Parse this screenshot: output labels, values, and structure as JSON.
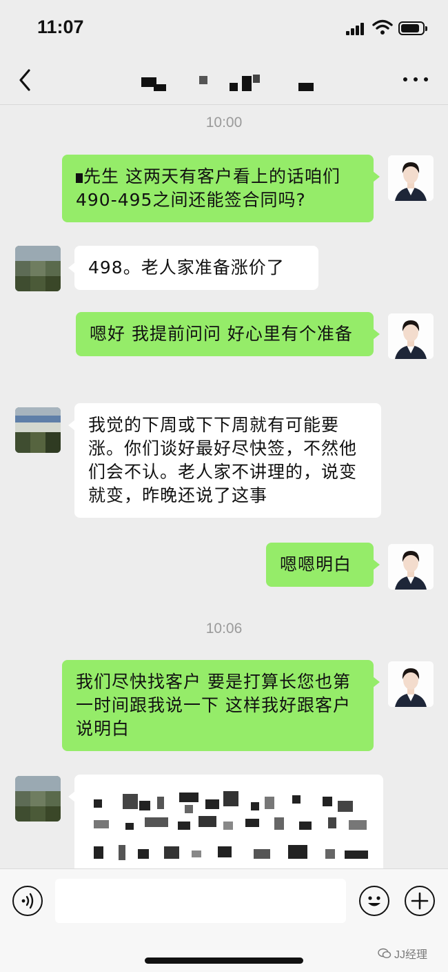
{
  "status_bar": {
    "time": "11:07"
  },
  "nav": {
    "title_redacted": true
  },
  "messages": [
    {
      "type": "timestamp",
      "text": "10:00"
    },
    {
      "type": "bubble",
      "sender": "self",
      "text": "先生 这两天有客户看上的话咱们490-495之间还能签合同吗?"
    },
    {
      "type": "bubble",
      "sender": "other",
      "text": "498。老人家准备涨价了"
    },
    {
      "type": "bubble",
      "sender": "self",
      "text": "嗯好 我提前问问 好心里有个准备"
    },
    {
      "type": "bubble",
      "sender": "other",
      "text": "我觉的下周或下下周就有可能要涨。你们谈好最好尽快签，不然他们会不认。老人家不讲理的，说变就变，昨晚还说了这事"
    },
    {
      "type": "bubble",
      "sender": "self",
      "text": "嗯嗯明白"
    },
    {
      "type": "timestamp",
      "text": "10:06"
    },
    {
      "type": "bubble",
      "sender": "self",
      "text": "我们尽快找客户 要是打算长您也第一时间跟我说一下 这样我好跟客户说明白"
    },
    {
      "type": "bubble",
      "sender": "other",
      "text_redacted": true
    }
  ],
  "input_bar": {
    "placeholder": ""
  },
  "watermark": {
    "text": "JJ经理"
  },
  "colors": {
    "self_bubble": "#95ec69",
    "other_bubble": "#ffffff",
    "background": "#ededed"
  }
}
